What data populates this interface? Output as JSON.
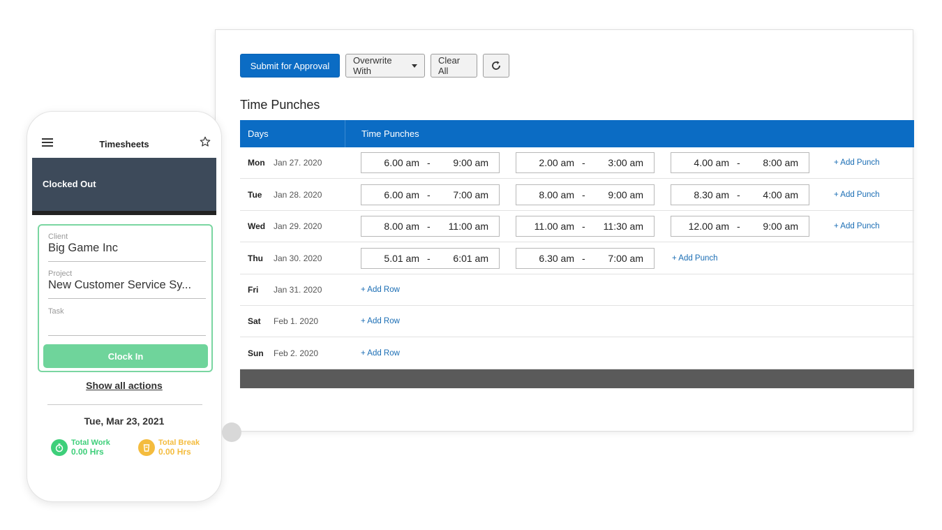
{
  "toolbar": {
    "submit_label": "Submit for Approval",
    "overwrite_label": "Overwrite With",
    "clear_label": "Clear All",
    "refresh_icon": "refresh-icon",
    "accent": "#0b6cc4"
  },
  "section_title": "Time Punches",
  "table": {
    "col_days": "Days",
    "col_punches": "Time Punches",
    "rows": [
      {
        "day": "Mon",
        "date": "Jan 27. 2020",
        "punches": [
          [
            "6.00 am",
            "9:00 am"
          ],
          [
            "2.00 am",
            "3:00 am"
          ],
          [
            "4.00 am",
            "8:00 am"
          ]
        ],
        "action": "+ Add Punch"
      },
      {
        "day": "Tue",
        "date": "Jan 28. 2020",
        "punches": [
          [
            "6.00 am",
            "7:00 am"
          ],
          [
            "8.00 am",
            "9:00 am"
          ],
          [
            "8.30 am",
            "4:00 am"
          ]
        ],
        "action": "+ Add Punch"
      },
      {
        "day": "Wed",
        "date": "Jan 29. 2020",
        "punches": [
          [
            "8.00 am",
            "11:00 am"
          ],
          [
            "11.00 am",
            "11:30 am"
          ],
          [
            "12.00 am",
            "9:00 am"
          ]
        ],
        "action": "+ Add Punch"
      },
      {
        "day": "Thu",
        "date": "Jan 30. 2020",
        "punches": [
          [
            "5.01 am",
            "6:01 am"
          ],
          [
            "6.30 am",
            "7:00 am"
          ]
        ],
        "action": "+ Add Punch"
      },
      {
        "day": "Fri",
        "date": "Jan 31. 2020",
        "punches": [],
        "action": "+ Add Row"
      },
      {
        "day": "Sat",
        "date": "Feb 1. 2020",
        "punches": [],
        "action": "+ Add Row"
      },
      {
        "day": "Sun",
        "date": "Feb 2. 2020",
        "punches": [],
        "action": "+ Add Row"
      }
    ]
  },
  "phone": {
    "title": "Timesheets",
    "status": "Clocked Out",
    "client_label": "Client",
    "client_value": "Big Game Inc",
    "project_label": "Project",
    "project_value": "New Customer Service Sy...",
    "task_label": "Task",
    "task_value": "",
    "clock_in_label": "Clock In",
    "show_all_label": "Show all actions",
    "date": "Tue, Mar 23, 2021",
    "total_work_label": "Total Work",
    "total_work_value": "0.00 Hrs",
    "total_break_label": "Total Break",
    "total_break_value": "0.00 Hrs",
    "work_color": "#3ecf7a",
    "break_color": "#f4bc3e"
  }
}
